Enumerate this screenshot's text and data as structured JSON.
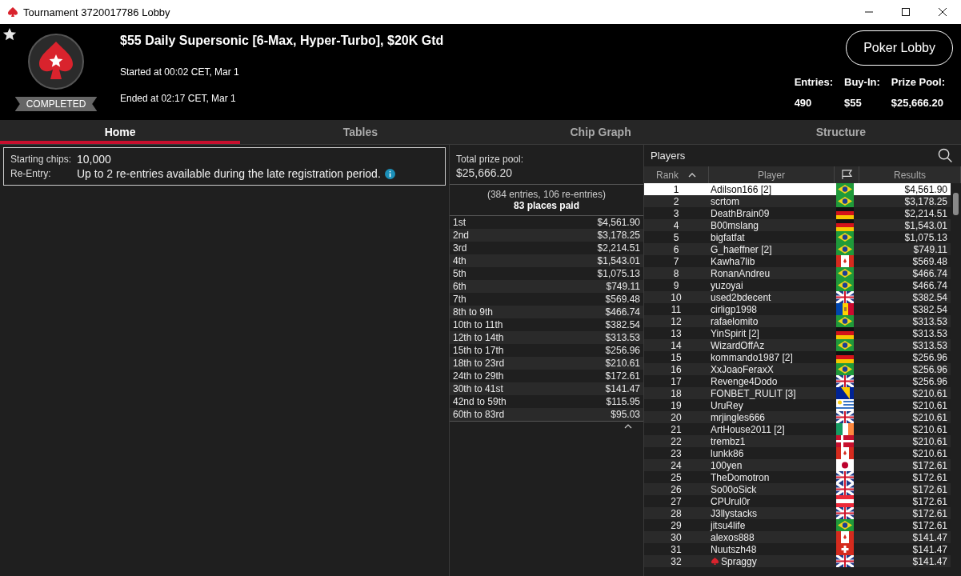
{
  "window": {
    "title": "Tournament 3720017786 Lobby"
  },
  "header": {
    "title": "$55 Daily Supersonic [6-Max, Hyper-Turbo], $20K Gtd",
    "started": "Started at 00:02 CET, Mar 1",
    "ended": "Ended at 02:17 CET, Mar 1",
    "status": "COMPLETED",
    "favorite": true,
    "lobby_button": "Poker Lobby",
    "stats": [
      {
        "label": "Entries:",
        "value": "490"
      },
      {
        "label": "Buy-In:",
        "value": "$55"
      },
      {
        "label": "Prize Pool:",
        "value": "$25,666.20"
      }
    ]
  },
  "tabs": [
    {
      "label": "Home",
      "selected": true
    },
    {
      "label": "Tables",
      "selected": false
    },
    {
      "label": "Chip Graph",
      "selected": false
    },
    {
      "label": "Structure",
      "selected": false
    }
  ],
  "info": [
    {
      "label": "Starting chips:",
      "value": "10,000",
      "info_icon": false
    },
    {
      "label": "Re-Entry:",
      "value": "Up to 2 re-entries available during the late registration period.",
      "info_icon": true
    }
  ],
  "prizes": {
    "total_label": "Total prize pool:",
    "total": "$25,666.20",
    "entries_note": "(384 entries, 106 re-entries)",
    "places_paid": "83 places paid",
    "rows": [
      {
        "place": "1st",
        "amount": "$4,561.90"
      },
      {
        "place": "2nd",
        "amount": "$3,178.25"
      },
      {
        "place": "3rd",
        "amount": "$2,214.51"
      },
      {
        "place": "4th",
        "amount": "$1,543.01"
      },
      {
        "place": "5th",
        "amount": "$1,075.13"
      },
      {
        "place": "6th",
        "amount": "$749.11"
      },
      {
        "place": "7th",
        "amount": "$569.48"
      },
      {
        "place": "8th to 9th",
        "amount": "$466.74"
      },
      {
        "place": "10th to 11th",
        "amount": "$382.54"
      },
      {
        "place": "12th to 14th",
        "amount": "$313.53"
      },
      {
        "place": "15th to 17th",
        "amount": "$256.96"
      },
      {
        "place": "18th to 23rd",
        "amount": "$210.61"
      },
      {
        "place": "24th to 29th",
        "amount": "$172.61"
      },
      {
        "place": "30th to 41st",
        "amount": "$141.47"
      },
      {
        "place": "42nd to 59th",
        "amount": "$115.95"
      },
      {
        "place": "60th to 83rd",
        "amount": "$95.03"
      }
    ]
  },
  "players": {
    "title": "Players",
    "columns": [
      "Rank",
      "Player",
      "Results"
    ],
    "rows": [
      {
        "rank": "1",
        "name": "Adilson166 [2]",
        "kind": "br",
        "result": "$4,561.90",
        "selected": true,
        "badge": false
      },
      {
        "rank": "2",
        "name": "scrtom",
        "kind": "br",
        "result": "$3,178.25",
        "selected": false,
        "badge": false
      },
      {
        "rank": "3",
        "name": "DeathBrain09",
        "kind": "de",
        "result": "$2,214.51",
        "selected": false,
        "badge": false
      },
      {
        "rank": "4",
        "name": "B00mslang",
        "kind": "de",
        "result": "$1,543.01",
        "selected": false,
        "badge": false
      },
      {
        "rank": "5",
        "name": "bigfatfat",
        "kind": "br",
        "result": "$1,075.13",
        "selected": false,
        "badge": false
      },
      {
        "rank": "6",
        "name": "G_haeffner [2]",
        "kind": "br",
        "result": "$749.11",
        "selected": false,
        "badge": false
      },
      {
        "rank": "7",
        "name": "Kawha7lib",
        "kind": "ca",
        "result": "$569.48",
        "selected": false,
        "badge": false
      },
      {
        "rank": "8",
        "name": "RonanAndreu",
        "kind": "br",
        "result": "$466.74",
        "selected": false,
        "badge": false
      },
      {
        "rank": "9",
        "name": "yuzoyai",
        "kind": "br",
        "result": "$466.74",
        "selected": false,
        "badge": false
      },
      {
        "rank": "10",
        "name": "used2bdecent",
        "kind": "gb",
        "result": "$382.54",
        "selected": false,
        "badge": false
      },
      {
        "rank": "11",
        "name": "cirligp1998",
        "kind": "md",
        "result": "$382.54",
        "selected": false,
        "badge": false
      },
      {
        "rank": "12",
        "name": "rafaelomito",
        "kind": "br",
        "result": "$313.53",
        "selected": false,
        "badge": false
      },
      {
        "rank": "13",
        "name": "YinSpirit [2]",
        "kind": "de",
        "result": "$313.53",
        "selected": false,
        "badge": false
      },
      {
        "rank": "14",
        "name": "WizardOffAz",
        "kind": "br",
        "result": "$313.53",
        "selected": false,
        "badge": false
      },
      {
        "rank": "15",
        "name": "kommando1987 [2]",
        "kind": "de",
        "result": "$256.96",
        "selected": false,
        "badge": false
      },
      {
        "rank": "16",
        "name": "XxJoaoFeraxX",
        "kind": "br",
        "result": "$256.96",
        "selected": false,
        "badge": false
      },
      {
        "rank": "17",
        "name": "Revenge4Dodo",
        "kind": "gb",
        "result": "$256.96",
        "selected": false,
        "badge": false
      },
      {
        "rank": "18",
        "name": "FONBET_RULIT [3]",
        "kind": "ba",
        "result": "$210.61",
        "selected": false,
        "badge": false
      },
      {
        "rank": "19",
        "name": "UruRey",
        "kind": "uy",
        "result": "$210.61",
        "selected": false,
        "badge": false
      },
      {
        "rank": "20",
        "name": "mrjingles666",
        "kind": "gb",
        "result": "$210.61",
        "selected": false,
        "badge": false
      },
      {
        "rank": "21",
        "name": "ArtHouse2011 [2]",
        "kind": "ie",
        "result": "$210.61",
        "selected": false,
        "badge": false
      },
      {
        "rank": "22",
        "name": "trembz1",
        "kind": "dk",
        "result": "$210.61",
        "selected": false,
        "badge": false
      },
      {
        "rank": "23",
        "name": "lunkk86",
        "kind": "ca",
        "result": "$210.61",
        "selected": false,
        "badge": false
      },
      {
        "rank": "24",
        "name": "100yen",
        "kind": "jp",
        "result": "$172.61",
        "selected": false,
        "badge": false
      },
      {
        "rank": "25",
        "name": "TheDomotron",
        "kind": "gb",
        "result": "$172.61",
        "selected": false,
        "badge": false
      },
      {
        "rank": "26",
        "name": "So00oSick",
        "kind": "gb",
        "result": "$172.61",
        "selected": false,
        "badge": false
      },
      {
        "rank": "27",
        "name": "CPUrul0r",
        "kind": "at",
        "result": "$172.61",
        "selected": false,
        "badge": false
      },
      {
        "rank": "28",
        "name": "J3llystacks",
        "kind": "gb",
        "result": "$172.61",
        "selected": false,
        "badge": false
      },
      {
        "rank": "29",
        "name": "jitsu4life",
        "kind": "br",
        "result": "$172.61",
        "selected": false,
        "badge": false
      },
      {
        "rank": "30",
        "name": "alexos888",
        "kind": "ca",
        "result": "$141.47",
        "selected": false,
        "badge": false
      },
      {
        "rank": "31",
        "name": "Nuutszh48",
        "kind": "ch",
        "result": "$141.47",
        "selected": false,
        "badge": false
      },
      {
        "rank": "32",
        "name": "Spraggy",
        "kind": "gb",
        "result": "$141.47",
        "selected": false,
        "badge": true
      }
    ]
  }
}
